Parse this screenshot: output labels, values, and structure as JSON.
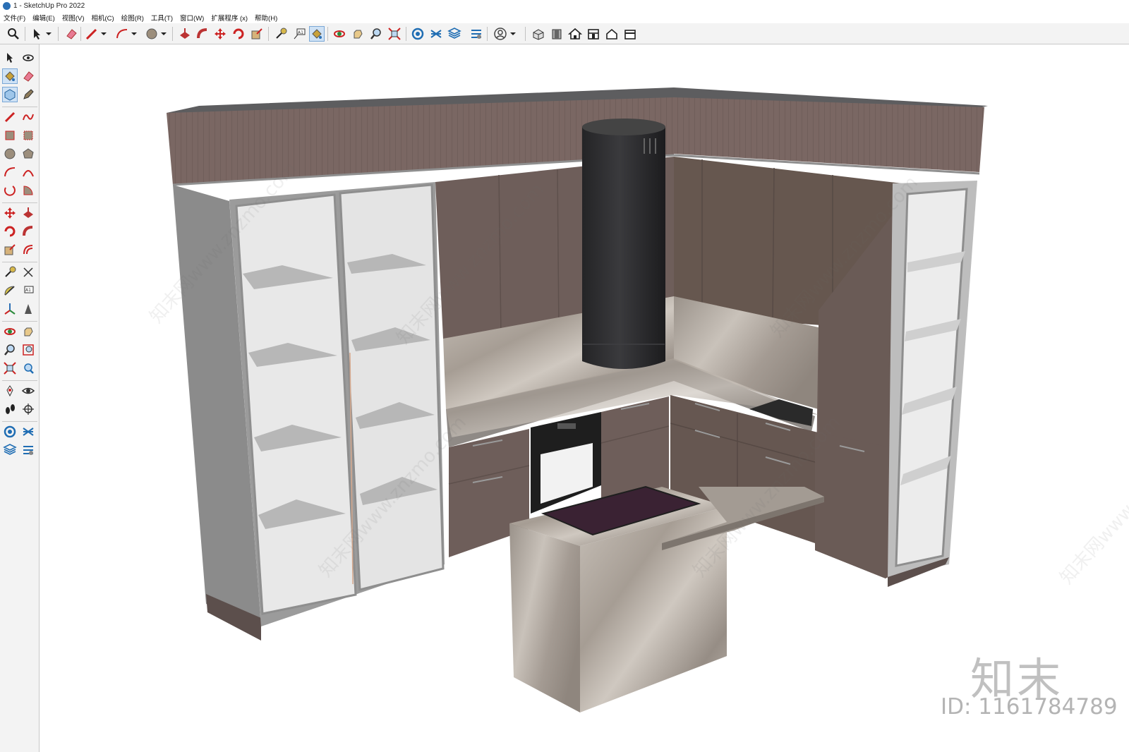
{
  "window": {
    "title": "1 - SketchUp Pro 2022"
  },
  "menu": {
    "items": [
      "文件(F)",
      "编辑(E)",
      "视图(V)",
      "相机(C)",
      "绘图(R)",
      "工具(T)",
      "窗口(W)",
      "扩展程序 (x)",
      "帮助(H)"
    ]
  },
  "toolbar": {
    "tools": [
      "search-icon",
      "select-icon",
      "dropdown-icon",
      "eraser-icon",
      "pencil-line-icon",
      "dropdown-icon",
      "arc-icon",
      "dropdown-icon",
      "circle-icon",
      "dropdown-icon",
      "push-pull-icon",
      "follow-me-icon",
      "move-icon",
      "rotate-icon",
      "scale-icon",
      "tape-measure-icon",
      "text-label-icon",
      "paint-bucket-icon",
      "orbit-icon",
      "pan-icon",
      "zoom-icon",
      "zoom-extents-icon",
      "component-icon",
      "sandbox-icon",
      "layers-icon",
      "styles-icon",
      "account-icon",
      "dropdown-icon",
      "iso-view-icon",
      "front-view-icon",
      "home-view-icon",
      "top-view-icon",
      "right-view-icon",
      "back-view-icon"
    ],
    "active_tool": "paint-bucket-icon"
  },
  "left_toolbar": {
    "tools": [
      "select-icon",
      "orbit-icon",
      "paint-bucket-icon",
      "eraser-icon",
      "component-icon",
      "tag-icon",
      "line-icon",
      "freehand-icon",
      "rectangle-icon",
      "rotated-rectangle-icon",
      "circle-icon",
      "polygon-icon",
      "arc-icon",
      "two-point-arc-icon",
      "three-point-arc-icon",
      "pie-icon",
      "move-icon",
      "push-pull-icon",
      "rotate-icon",
      "follow-me-icon",
      "scale-icon",
      "offset-icon",
      "tape-measure-icon",
      "dimension-icon",
      "protractor-icon",
      "text-icon",
      "axes-icon",
      "3d-text-icon",
      "orbit-view-icon",
      "pan-icon",
      "zoom-icon",
      "zoom-window-icon",
      "zoom-extents-icon",
      "previous-view-icon",
      "position-camera-icon",
      "look-around-icon",
      "walk-icon",
      "section-plane-icon",
      "warehouse-icon",
      "extension-icon",
      "layers-icon",
      "outliner-icon"
    ],
    "active_tool": "paint-bucket-icon"
  },
  "scene": {
    "description_label": "kitchen-model",
    "colors": {
      "cabinet": "#6e5e5a",
      "cabinet_dark": "#5f514d",
      "frame": "#9c9c9c",
      "top_band": "#7a6763",
      "glass": "#e9e9e9",
      "shelf": "#b7b7b7",
      "hood": "#2f2f31",
      "marble": "#b8b0a8",
      "induction": "#3a2233",
      "oven": "#1e1e1e"
    }
  },
  "watermark": {
    "repeat_text": "知末网www.znzmo.com",
    "brand": "知末",
    "id_text": "ID: 1161784789"
  }
}
